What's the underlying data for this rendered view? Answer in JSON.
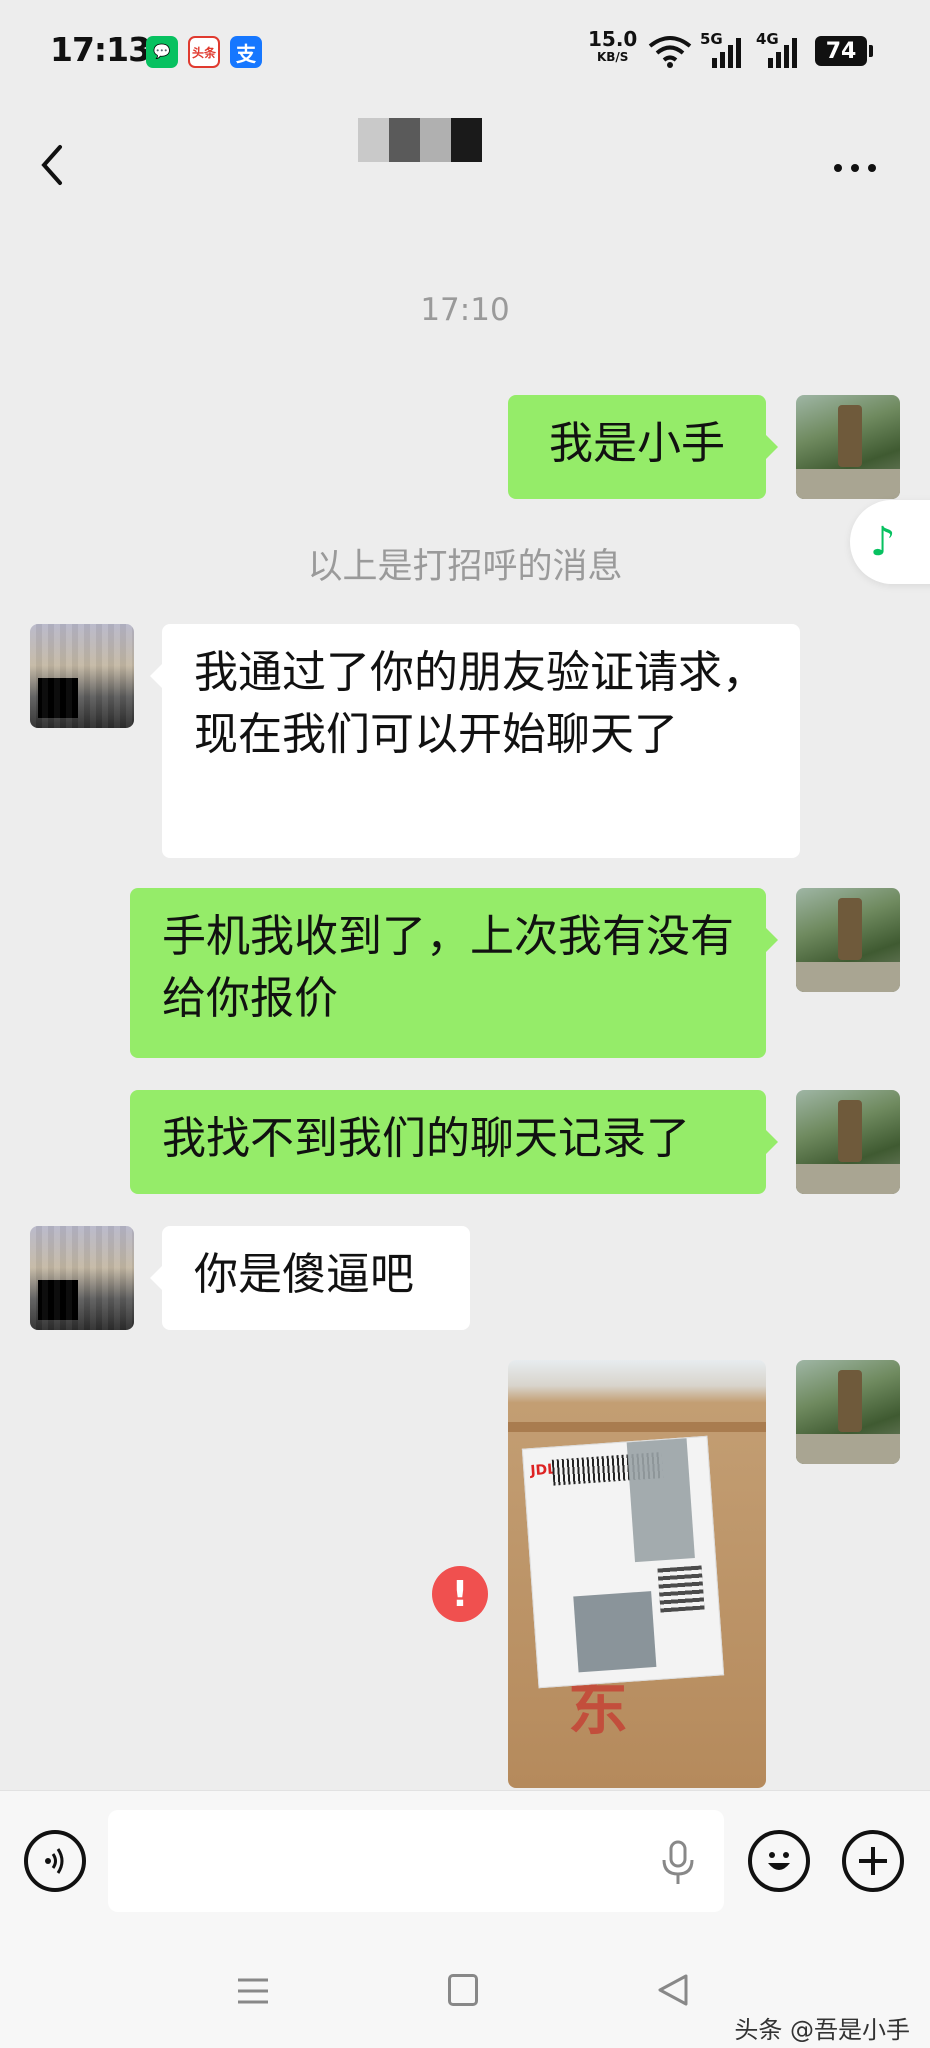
{
  "status_bar": {
    "time": "17:13",
    "app_badges": {
      "wechat": "💬",
      "toutiao": "头条",
      "alipay": "支"
    },
    "net_speed_value": "15.0",
    "net_speed_unit": "KB/S",
    "network_5g": "5G",
    "network_4g": "4G",
    "battery": "74"
  },
  "nav": {
    "back_icon": "back-chevron-icon",
    "more_icon": "more-dots-icon"
  },
  "chat": {
    "timestamp": "17:10",
    "system_note": "以上是打招呼的消息",
    "messages": [
      {
        "side": "out",
        "text": "我是小手"
      },
      {
        "side": "in",
        "text": "我通过了你的朋友验证请求，现在我们可以开始聊天了"
      },
      {
        "side": "out",
        "text": "手机我收到了，上次我有没有给你报价"
      },
      {
        "side": "out",
        "text": "我找不到我们的聊天记录了"
      },
      {
        "side": "in",
        "text": "你是傻逼吧"
      }
    ],
    "image_message": {
      "label_logo": "JDL",
      "failed_indicator": "!"
    }
  },
  "floating": {
    "music_icon": "♪"
  },
  "input_bar": {
    "value": "",
    "placeholder": ""
  },
  "watermark": "头条 @吾是小手",
  "colors": {
    "bubble_out": "#95ec69",
    "bubble_in": "#ffffff",
    "background": "#ededed",
    "error": "#f0504f",
    "wechat_green": "#07c160"
  }
}
